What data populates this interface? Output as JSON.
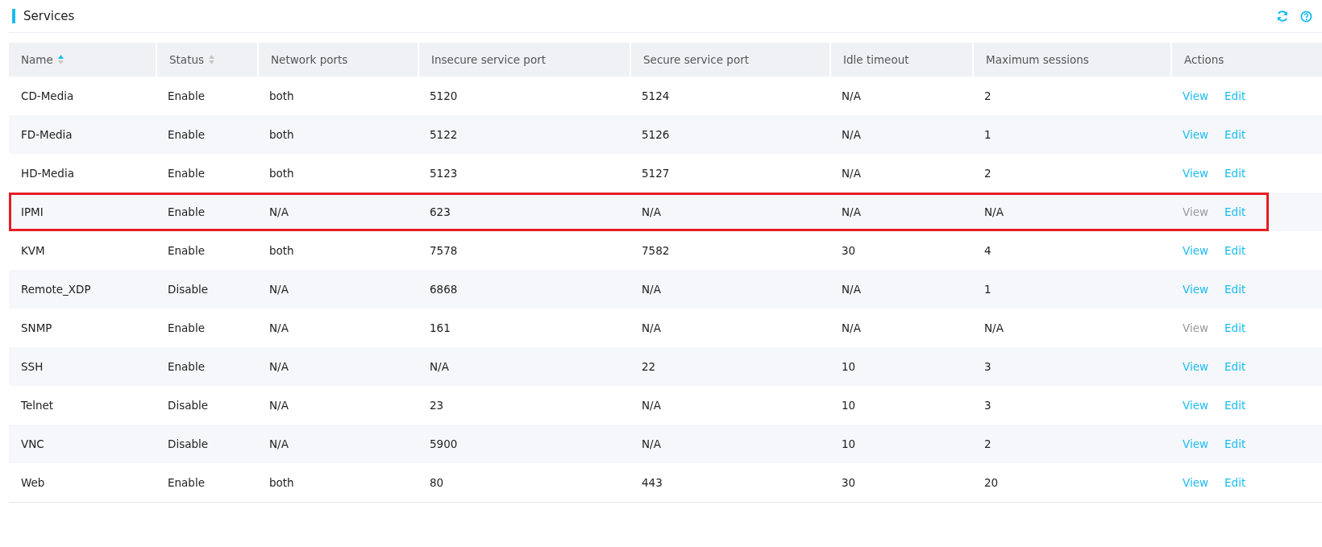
{
  "header": {
    "title": "Services"
  },
  "table": {
    "columns": [
      {
        "label": "Name",
        "sorted": true
      },
      {
        "label": "Status",
        "sorted": false
      },
      {
        "label": "Network ports"
      },
      {
        "label": "Insecure service port"
      },
      {
        "label": "Secure service port"
      },
      {
        "label": "Idle timeout"
      },
      {
        "label": "Maximum sessions"
      },
      {
        "label": "Actions"
      }
    ],
    "rows": [
      {
        "cells": [
          "CD-Media",
          "Enable",
          "both",
          "5120",
          "5124",
          "N/A",
          "2"
        ],
        "highlighted": false,
        "actions": [
          {
            "label": "View",
            "disabled": false
          },
          {
            "label": "Edit",
            "disabled": false
          }
        ]
      },
      {
        "cells": [
          "FD-Media",
          "Enable",
          "both",
          "5122",
          "5126",
          "N/A",
          "1"
        ],
        "highlighted": false,
        "actions": [
          {
            "label": "View",
            "disabled": false
          },
          {
            "label": "Edit",
            "disabled": false
          }
        ]
      },
      {
        "cells": [
          "HD-Media",
          "Enable",
          "both",
          "5123",
          "5127",
          "N/A",
          "2"
        ],
        "highlighted": false,
        "actions": [
          {
            "label": "View",
            "disabled": false
          },
          {
            "label": "Edit",
            "disabled": false
          }
        ]
      },
      {
        "cells": [
          "IPMI",
          "Enable",
          "N/A",
          "623",
          "N/A",
          "N/A",
          "N/A"
        ],
        "highlighted": true,
        "actions": [
          {
            "label": "View",
            "disabled": true
          },
          {
            "label": "Edit",
            "disabled": false
          }
        ]
      },
      {
        "cells": [
          "KVM",
          "Enable",
          "both",
          "7578",
          "7582",
          "30",
          "4"
        ],
        "highlighted": false,
        "actions": [
          {
            "label": "View",
            "disabled": false
          },
          {
            "label": "Edit",
            "disabled": false
          }
        ]
      },
      {
        "cells": [
          "Remote_XDP",
          "Disable",
          "N/A",
          "6868",
          "N/A",
          "N/A",
          "1"
        ],
        "highlighted": false,
        "actions": [
          {
            "label": "View",
            "disabled": false
          },
          {
            "label": "Edit",
            "disabled": false
          }
        ]
      },
      {
        "cells": [
          "SNMP",
          "Enable",
          "N/A",
          "161",
          "N/A",
          "N/A",
          "N/A"
        ],
        "highlighted": false,
        "actions": [
          {
            "label": "View",
            "disabled": true
          },
          {
            "label": "Edit",
            "disabled": false
          }
        ]
      },
      {
        "cells": [
          "SSH",
          "Enable",
          "N/A",
          "N/A",
          "22",
          "10",
          "3"
        ],
        "highlighted": false,
        "actions": [
          {
            "label": "View",
            "disabled": false
          },
          {
            "label": "Edit",
            "disabled": false
          }
        ]
      },
      {
        "cells": [
          "Telnet",
          "Disable",
          "N/A",
          "23",
          "N/A",
          "10",
          "3"
        ],
        "highlighted": false,
        "actions": [
          {
            "label": "View",
            "disabled": false
          },
          {
            "label": "Edit",
            "disabled": false
          }
        ]
      },
      {
        "cells": [
          "VNC",
          "Disable",
          "N/A",
          "5900",
          "N/A",
          "10",
          "2"
        ],
        "highlighted": false,
        "actions": [
          {
            "label": "View",
            "disabled": false
          },
          {
            "label": "Edit",
            "disabled": false
          }
        ]
      },
      {
        "cells": [
          "Web",
          "Enable",
          "both",
          "80",
          "443",
          "30",
          "20"
        ],
        "highlighted": false,
        "actions": [
          {
            "label": "View",
            "disabled": false
          },
          {
            "label": "Edit",
            "disabled": false
          }
        ]
      }
    ]
  }
}
